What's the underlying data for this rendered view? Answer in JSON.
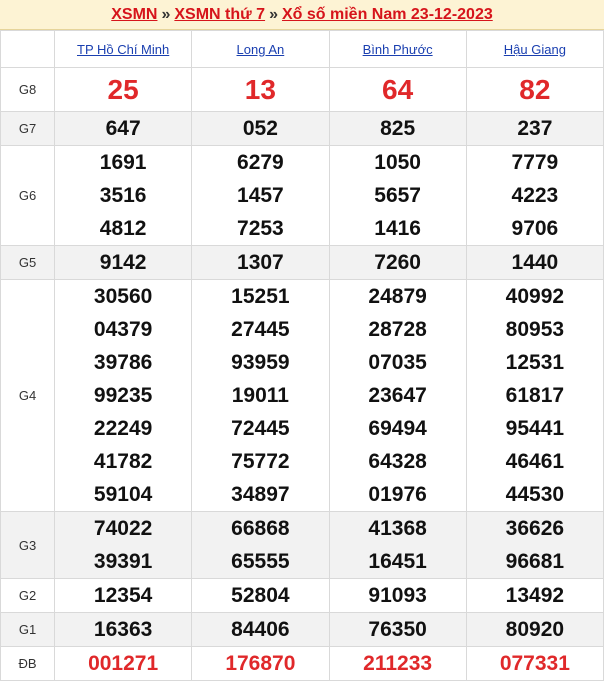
{
  "breadcrumb": {
    "item1": "XSMN",
    "sep": "»",
    "item2": "XSMN thứ 7",
    "item3": "Xổ số miền Nam 23-12-2023"
  },
  "provinces": [
    "TP Hồ Chí Minh",
    "Long An",
    "Bình Phước",
    "Hậu Giang"
  ],
  "prizes": [
    {
      "label": "G8",
      "style": "big",
      "values": [
        [
          "25"
        ],
        [
          "13"
        ],
        [
          "64"
        ],
        [
          "82"
        ]
      ]
    },
    {
      "label": "G7",
      "style": "num",
      "values": [
        [
          "647"
        ],
        [
          "052"
        ],
        [
          "825"
        ],
        [
          "237"
        ]
      ]
    },
    {
      "label": "G6",
      "style": "num",
      "values": [
        [
          "1691",
          "3516",
          "4812"
        ],
        [
          "6279",
          "1457",
          "7253"
        ],
        [
          "1050",
          "5657",
          "1416"
        ],
        [
          "7779",
          "4223",
          "9706"
        ]
      ]
    },
    {
      "label": "G5",
      "style": "num",
      "values": [
        [
          "9142"
        ],
        [
          "1307"
        ],
        [
          "7260"
        ],
        [
          "1440"
        ]
      ]
    },
    {
      "label": "G4",
      "style": "num",
      "values": [
        [
          "30560",
          "04379",
          "39786",
          "99235",
          "22249",
          "41782",
          "59104"
        ],
        [
          "15251",
          "27445",
          "93959",
          "19011",
          "72445",
          "75772",
          "34897"
        ],
        [
          "24879",
          "28728",
          "07035",
          "23647",
          "69494",
          "64328",
          "01976"
        ],
        [
          "40992",
          "80953",
          "12531",
          "61817",
          "95441",
          "46461",
          "44530"
        ]
      ]
    },
    {
      "label": "G3",
      "style": "num",
      "values": [
        [
          "74022",
          "39391"
        ],
        [
          "66868",
          "65555"
        ],
        [
          "41368",
          "16451"
        ],
        [
          "36626",
          "96681"
        ]
      ]
    },
    {
      "label": "G2",
      "style": "num",
      "values": [
        [
          "12354"
        ],
        [
          "52804"
        ],
        [
          "91093"
        ],
        [
          "13492"
        ]
      ]
    },
    {
      "label": "G1",
      "style": "num",
      "values": [
        [
          "16363"
        ],
        [
          "84406"
        ],
        [
          "76350"
        ],
        [
          "80920"
        ]
      ]
    },
    {
      "label": "ĐB",
      "style": "db",
      "values": [
        [
          "001271"
        ],
        [
          "176870"
        ],
        [
          "211233"
        ],
        [
          "077331"
        ]
      ]
    }
  ],
  "colors": {
    "accent": "#e0282a",
    "link": "#1a3fb0",
    "header_bg": "#fdf3d4",
    "alt_row": "#f2f2f2"
  }
}
